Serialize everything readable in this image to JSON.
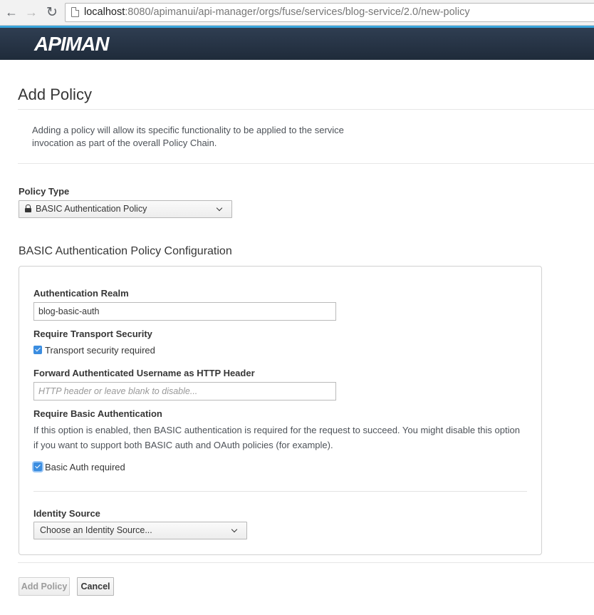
{
  "browser": {
    "url_host": "localhost",
    "url_path": ":8080/apimanui/api-manager/orgs/fuse/services/blog-service/2.0/new-policy"
  },
  "header": {
    "logo": "APIMAN"
  },
  "page": {
    "title": "Add Policy",
    "description": "Adding a policy will allow its specific functionality to be applied to the service invocation as part of the overall Policy Chain."
  },
  "policy_type": {
    "label": "Policy Type",
    "selected": "BASIC Authentication Policy"
  },
  "config": {
    "title": "BASIC Authentication Policy Configuration",
    "realm": {
      "label": "Authentication Realm",
      "value": "blog-basic-auth"
    },
    "transport": {
      "label": "Require Transport Security",
      "checkbox_label": "Transport security required",
      "checked": true
    },
    "forward_header": {
      "label": "Forward Authenticated Username as HTTP Header",
      "placeholder": "HTTP header or leave blank to disable..."
    },
    "basic_auth": {
      "label": "Require Basic Authentication",
      "help": "If this option is enabled, then BASIC authentication is required for the request to succeed. You might disable this option if you want to support both BASIC auth and OAuth policies (for example).",
      "checkbox_label": "Basic Auth required",
      "checked": true
    },
    "identity_source": {
      "label": "Identity Source",
      "selected": "Choose an Identity Source..."
    }
  },
  "actions": {
    "add_label": "Add Policy",
    "cancel_label": "Cancel"
  },
  "colors": {
    "accent": "#39a5dc",
    "header_bg": "#1f2b3a",
    "checkbox": "#3b8de0"
  }
}
